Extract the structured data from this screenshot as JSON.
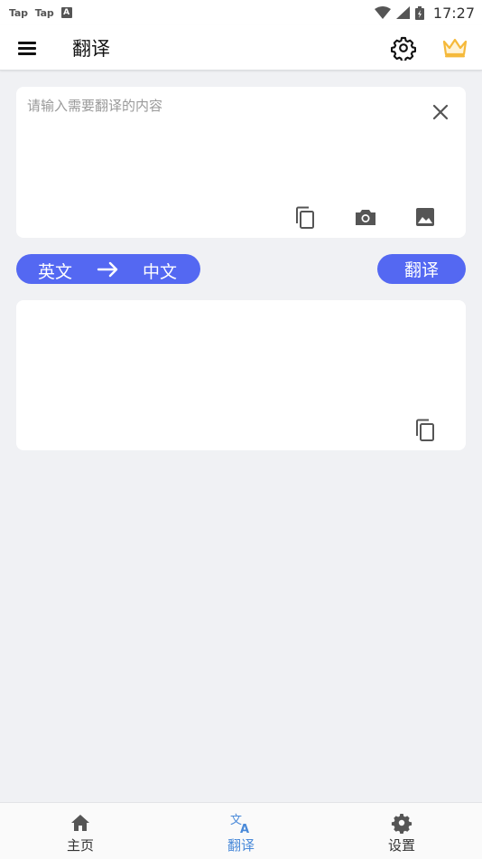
{
  "status_bar": {
    "app_icons": [
      "Tap",
      "Tap",
      "A"
    ],
    "time": "17:27"
  },
  "app_bar": {
    "title": "翻译",
    "menu_icon": "hamburger-menu-icon",
    "settings_icon": "gear-icon",
    "vip_icon": "crown-icon"
  },
  "input_card": {
    "placeholder": "请输入需要翻译的内容",
    "value": "",
    "actions": [
      "clear-icon",
      "paste-icon",
      "camera-icon",
      "image-icon"
    ]
  },
  "language": {
    "source": "英文",
    "target": "中文"
  },
  "translate_button": "翻译",
  "output_card": {
    "text": "",
    "actions": [
      "copy-icon"
    ]
  },
  "bottom_nav": {
    "items": [
      {
        "label": "主页",
        "icon": "home-icon",
        "active": false
      },
      {
        "label": "翻译",
        "icon": "translate-icon",
        "active": true
      },
      {
        "label": "设置",
        "icon": "gear-icon",
        "active": false
      }
    ]
  },
  "colors": {
    "accent": "#5468f2",
    "nav_active": "#4a8ad9",
    "background": "#f0f1f4",
    "crown": "#f5b93a"
  }
}
